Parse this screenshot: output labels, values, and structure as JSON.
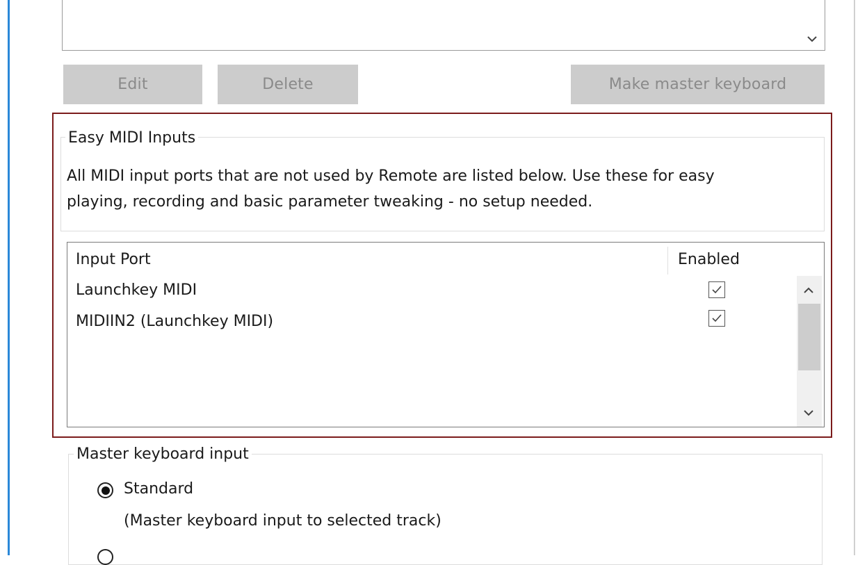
{
  "buttons": {
    "edit": "Edit",
    "delete": "Delete",
    "make_master": "Make master keyboard"
  },
  "easy_midi": {
    "title": "Easy MIDI Inputs",
    "desc_line1": "All MIDI input ports that are not used by Remote are listed below. Use these for easy",
    "desc_line2": "playing, recording and basic parameter tweaking - no setup needed.",
    "columns": {
      "port": "Input Port",
      "enabled": "Enabled"
    },
    "rows": [
      {
        "port": "Launchkey MIDI",
        "enabled": true
      },
      {
        "port": "MIDIIN2 (Launchkey MIDI)",
        "enabled": true
      }
    ]
  },
  "master": {
    "title": "Master keyboard input",
    "option_standard": "Standard",
    "option_standard_desc": "(Master keyboard input to selected track)",
    "selected": "Standard"
  },
  "colors": {
    "highlight_border": "#7b1b1b",
    "button_disabled_bg": "#cccccc",
    "button_disabled_text": "#8a8a8a",
    "window_edge": "#2b88d8"
  },
  "icons": {
    "scroll_down": "chevron-down-icon",
    "scroll_up": "chevron-up-icon",
    "checkbox": "check-icon",
    "radio": "radio-selected-icon"
  }
}
